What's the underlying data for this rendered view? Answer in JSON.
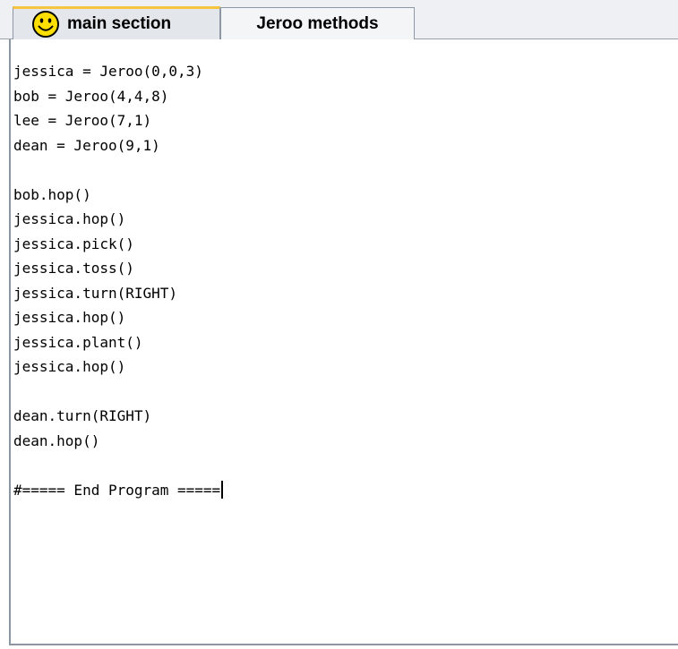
{
  "tabs": [
    {
      "label": "main section",
      "icon": "smiley-face-icon",
      "active": true
    },
    {
      "label": "Jeroo methods",
      "active": false
    }
  ],
  "editor": {
    "lines": [
      "jessica = Jeroo(0,0,3)",
      "bob = Jeroo(4,4,8)",
      "lee = Jeroo(7,1)",
      "dean = Jeroo(9,1)",
      "",
      "bob.hop()",
      "jessica.hop()",
      "jessica.pick()",
      "jessica.toss()",
      "jessica.turn(RIGHT)",
      "jessica.hop()",
      "jessica.plant()",
      "jessica.hop()",
      "",
      "dean.turn(RIGHT)",
      "dean.hop()",
      "",
      "#===== End Program ====="
    ]
  },
  "colors": {
    "tab_accent": "#f5c542",
    "smiley_fill": "#ffdf00"
  }
}
